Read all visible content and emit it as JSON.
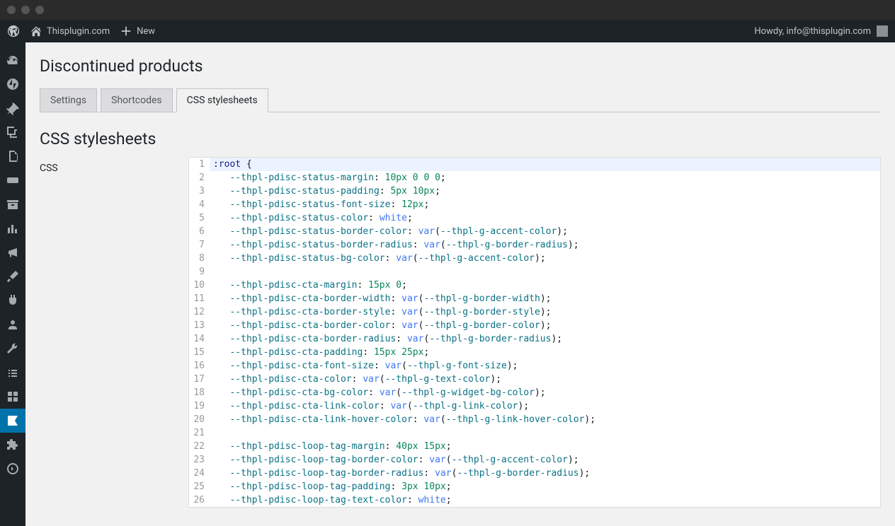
{
  "adminbar": {
    "site_name": "Thisplugin.com",
    "new_label": "New",
    "howdy": "Howdy, info@thisplugin.com"
  },
  "page": {
    "title": "Discontinued products",
    "section_title": "CSS stylesheets",
    "form_label": "CSS"
  },
  "tabs": [
    {
      "label": "Settings",
      "active": false
    },
    {
      "label": "Shortcodes",
      "active": false
    },
    {
      "label": "CSS stylesheets",
      "active": true
    }
  ],
  "code_lines": [
    {
      "n": 1,
      "active": true,
      "tokens": [
        [
          "def",
          ":root"
        ],
        [
          "plain",
          " "
        ],
        [
          "punct",
          "{"
        ]
      ]
    },
    {
      "n": 2,
      "tokens": [
        [
          "plain",
          "   "
        ],
        [
          "var",
          "--thpl-pdisc-status-margin"
        ],
        [
          "punct",
          ":"
        ],
        [
          "plain",
          " "
        ],
        [
          "num",
          "10px"
        ],
        [
          "plain",
          " "
        ],
        [
          "num",
          "0"
        ],
        [
          "plain",
          " "
        ],
        [
          "num",
          "0"
        ],
        [
          "plain",
          " "
        ],
        [
          "num",
          "0"
        ],
        [
          "punct",
          ";"
        ]
      ]
    },
    {
      "n": 3,
      "tokens": [
        [
          "plain",
          "   "
        ],
        [
          "var",
          "--thpl-pdisc-status-padding"
        ],
        [
          "punct",
          ":"
        ],
        [
          "plain",
          " "
        ],
        [
          "num",
          "5px"
        ],
        [
          "plain",
          " "
        ],
        [
          "num",
          "10px"
        ],
        [
          "punct",
          ";"
        ]
      ]
    },
    {
      "n": 4,
      "tokens": [
        [
          "plain",
          "   "
        ],
        [
          "var",
          "--thpl-pdisc-status-font-size"
        ],
        [
          "punct",
          ":"
        ],
        [
          "plain",
          " "
        ],
        [
          "num",
          "12px"
        ],
        [
          "punct",
          ";"
        ]
      ]
    },
    {
      "n": 5,
      "tokens": [
        [
          "plain",
          "   "
        ],
        [
          "var",
          "--thpl-pdisc-status-color"
        ],
        [
          "punct",
          ":"
        ],
        [
          "plain",
          " "
        ],
        [
          "kw",
          "white"
        ],
        [
          "punct",
          ";"
        ]
      ]
    },
    {
      "n": 6,
      "tokens": [
        [
          "plain",
          "   "
        ],
        [
          "var",
          "--thpl-pdisc-status-border-color"
        ],
        [
          "punct",
          ":"
        ],
        [
          "plain",
          " "
        ],
        [
          "fn",
          "var"
        ],
        [
          "paren",
          "("
        ],
        [
          "var",
          "--thpl-g-accent-color"
        ],
        [
          "paren",
          ")"
        ],
        [
          "punct",
          ";"
        ]
      ]
    },
    {
      "n": 7,
      "tokens": [
        [
          "plain",
          "   "
        ],
        [
          "var",
          "--thpl-pdisc-status-border-radius"
        ],
        [
          "punct",
          ":"
        ],
        [
          "plain",
          " "
        ],
        [
          "fn",
          "var"
        ],
        [
          "paren",
          "("
        ],
        [
          "var",
          "--thpl-g-border-radius"
        ],
        [
          "paren",
          ")"
        ],
        [
          "punct",
          ";"
        ]
      ]
    },
    {
      "n": 8,
      "tokens": [
        [
          "plain",
          "   "
        ],
        [
          "var",
          "--thpl-pdisc-status-bg-color"
        ],
        [
          "punct",
          ":"
        ],
        [
          "plain",
          " "
        ],
        [
          "fn",
          "var"
        ],
        [
          "paren",
          "("
        ],
        [
          "var",
          "--thpl-g-accent-color"
        ],
        [
          "paren",
          ")"
        ],
        [
          "punct",
          ";"
        ]
      ]
    },
    {
      "n": 9,
      "tokens": []
    },
    {
      "n": 10,
      "tokens": [
        [
          "plain",
          "   "
        ],
        [
          "var",
          "--thpl-pdisc-cta-margin"
        ],
        [
          "punct",
          ":"
        ],
        [
          "plain",
          " "
        ],
        [
          "num",
          "15px"
        ],
        [
          "plain",
          " "
        ],
        [
          "num",
          "0"
        ],
        [
          "punct",
          ";"
        ]
      ]
    },
    {
      "n": 11,
      "tokens": [
        [
          "plain",
          "   "
        ],
        [
          "var",
          "--thpl-pdisc-cta-border-width"
        ],
        [
          "punct",
          ":"
        ],
        [
          "plain",
          " "
        ],
        [
          "fn",
          "var"
        ],
        [
          "paren",
          "("
        ],
        [
          "var",
          "--thpl-g-border-width"
        ],
        [
          "paren",
          ")"
        ],
        [
          "punct",
          ";"
        ]
      ]
    },
    {
      "n": 12,
      "tokens": [
        [
          "plain",
          "   "
        ],
        [
          "var",
          "--thpl-pdisc-cta-border-style"
        ],
        [
          "punct",
          ":"
        ],
        [
          "plain",
          " "
        ],
        [
          "fn",
          "var"
        ],
        [
          "paren",
          "("
        ],
        [
          "var",
          "--thpl-g-border-style"
        ],
        [
          "paren",
          ")"
        ],
        [
          "punct",
          ";"
        ]
      ]
    },
    {
      "n": 13,
      "tokens": [
        [
          "plain",
          "   "
        ],
        [
          "var",
          "--thpl-pdisc-cta-border-color"
        ],
        [
          "punct",
          ":"
        ],
        [
          "plain",
          " "
        ],
        [
          "fn",
          "var"
        ],
        [
          "paren",
          "("
        ],
        [
          "var",
          "--thpl-g-border-color"
        ],
        [
          "paren",
          ")"
        ],
        [
          "punct",
          ";"
        ]
      ]
    },
    {
      "n": 14,
      "tokens": [
        [
          "plain",
          "   "
        ],
        [
          "var",
          "--thpl-pdisc-cta-border-radius"
        ],
        [
          "punct",
          ":"
        ],
        [
          "plain",
          " "
        ],
        [
          "fn",
          "var"
        ],
        [
          "paren",
          "("
        ],
        [
          "var",
          "--thpl-g-border-radius"
        ],
        [
          "paren",
          ")"
        ],
        [
          "punct",
          ";"
        ]
      ]
    },
    {
      "n": 15,
      "tokens": [
        [
          "plain",
          "   "
        ],
        [
          "var",
          "--thpl-pdisc-cta-padding"
        ],
        [
          "punct",
          ":"
        ],
        [
          "plain",
          " "
        ],
        [
          "num",
          "15px"
        ],
        [
          "plain",
          " "
        ],
        [
          "num",
          "25px"
        ],
        [
          "punct",
          ";"
        ]
      ]
    },
    {
      "n": 16,
      "tokens": [
        [
          "plain",
          "   "
        ],
        [
          "var",
          "--thpl-pdisc-cta-font-size"
        ],
        [
          "punct",
          ":"
        ],
        [
          "plain",
          " "
        ],
        [
          "fn",
          "var"
        ],
        [
          "paren",
          "("
        ],
        [
          "var",
          "--thpl-g-font-size"
        ],
        [
          "paren",
          ")"
        ],
        [
          "punct",
          ";"
        ]
      ]
    },
    {
      "n": 17,
      "tokens": [
        [
          "plain",
          "   "
        ],
        [
          "var",
          "--thpl-pdisc-cta-color"
        ],
        [
          "punct",
          ":"
        ],
        [
          "plain",
          " "
        ],
        [
          "fn",
          "var"
        ],
        [
          "paren",
          "("
        ],
        [
          "var",
          "--thpl-g-text-color"
        ],
        [
          "paren",
          ")"
        ],
        [
          "punct",
          ";"
        ]
      ]
    },
    {
      "n": 18,
      "tokens": [
        [
          "plain",
          "   "
        ],
        [
          "var",
          "--thpl-pdisc-cta-bg-color"
        ],
        [
          "punct",
          ":"
        ],
        [
          "plain",
          " "
        ],
        [
          "fn",
          "var"
        ],
        [
          "paren",
          "("
        ],
        [
          "var",
          "--thpl-g-widget-bg-color"
        ],
        [
          "paren",
          ")"
        ],
        [
          "punct",
          ";"
        ]
      ]
    },
    {
      "n": 19,
      "tokens": [
        [
          "plain",
          "   "
        ],
        [
          "var",
          "--thpl-pdisc-cta-link-color"
        ],
        [
          "punct",
          ":"
        ],
        [
          "plain",
          " "
        ],
        [
          "fn",
          "var"
        ],
        [
          "paren",
          "("
        ],
        [
          "var",
          "--thpl-g-link-color"
        ],
        [
          "paren",
          ")"
        ],
        [
          "punct",
          ";"
        ]
      ]
    },
    {
      "n": 20,
      "tokens": [
        [
          "plain",
          "   "
        ],
        [
          "var",
          "--thpl-pdisc-cta-link-hover-color"
        ],
        [
          "punct",
          ":"
        ],
        [
          "plain",
          " "
        ],
        [
          "fn",
          "var"
        ],
        [
          "paren",
          "("
        ],
        [
          "var",
          "--thpl-g-link-hover-color"
        ],
        [
          "paren",
          ")"
        ],
        [
          "punct",
          ";"
        ]
      ]
    },
    {
      "n": 21,
      "tokens": []
    },
    {
      "n": 22,
      "tokens": [
        [
          "plain",
          "   "
        ],
        [
          "var",
          "--thpl-pdisc-loop-tag-margin"
        ],
        [
          "punct",
          ":"
        ],
        [
          "plain",
          " "
        ],
        [
          "num",
          "40px"
        ],
        [
          "plain",
          " "
        ],
        [
          "num",
          "15px"
        ],
        [
          "punct",
          ";"
        ]
      ]
    },
    {
      "n": 23,
      "tokens": [
        [
          "plain",
          "   "
        ],
        [
          "var",
          "--thpl-pdisc-loop-tag-border-color"
        ],
        [
          "punct",
          ":"
        ],
        [
          "plain",
          " "
        ],
        [
          "fn",
          "var"
        ],
        [
          "paren",
          "("
        ],
        [
          "var",
          "--thpl-g-accent-color"
        ],
        [
          "paren",
          ")"
        ],
        [
          "punct",
          ";"
        ]
      ]
    },
    {
      "n": 24,
      "tokens": [
        [
          "plain",
          "   "
        ],
        [
          "var",
          "--thpl-pdisc-loop-tag-border-radius"
        ],
        [
          "punct",
          ":"
        ],
        [
          "plain",
          " "
        ],
        [
          "fn",
          "var"
        ],
        [
          "paren",
          "("
        ],
        [
          "var",
          "--thpl-g-border-radius"
        ],
        [
          "paren",
          ")"
        ],
        [
          "punct",
          ";"
        ]
      ]
    },
    {
      "n": 25,
      "tokens": [
        [
          "plain",
          "   "
        ],
        [
          "var",
          "--thpl-pdisc-loop-tag-padding"
        ],
        [
          "punct",
          ":"
        ],
        [
          "plain",
          " "
        ],
        [
          "num",
          "3px"
        ],
        [
          "plain",
          " "
        ],
        [
          "num",
          "10px"
        ],
        [
          "punct",
          ";"
        ]
      ]
    },
    {
      "n": 26,
      "tokens": [
        [
          "plain",
          "   "
        ],
        [
          "var",
          "--thpl-pdisc-loop-tag-text-color"
        ],
        [
          "punct",
          ":"
        ],
        [
          "plain",
          " "
        ],
        [
          "kw",
          "white"
        ],
        [
          "punct",
          ";"
        ]
      ]
    }
  ]
}
